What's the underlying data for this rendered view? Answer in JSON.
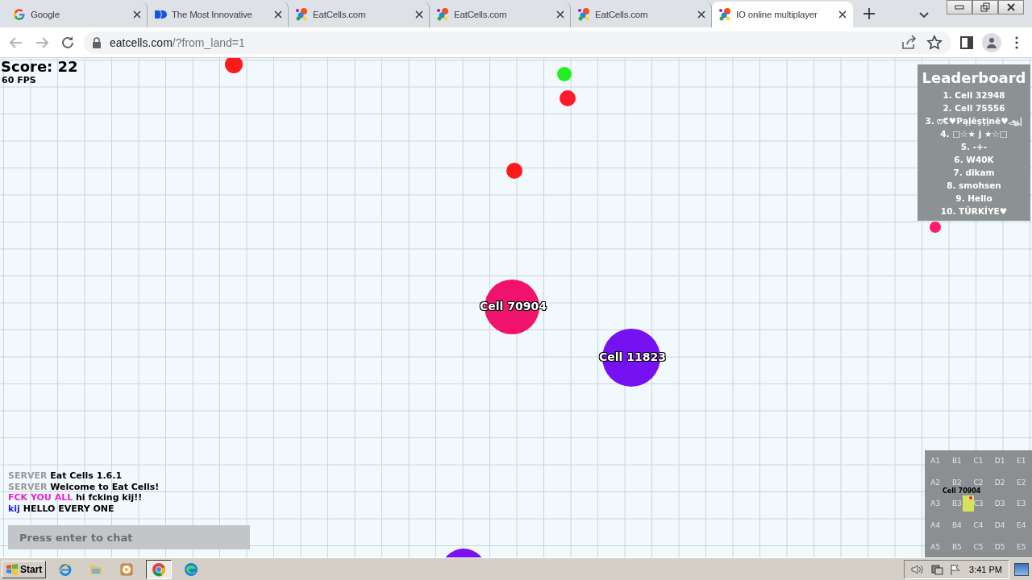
{
  "browser": {
    "tabs": [
      {
        "title": "Google",
        "kind": "google",
        "selected": false
      },
      {
        "title": "The Most Innovative",
        "kind": "flag",
        "selected": false
      },
      {
        "title": "EatCells.com",
        "kind": "cells",
        "selected": false
      },
      {
        "title": "EatCells.com",
        "kind": "cells",
        "selected": false
      },
      {
        "title": "EatCells.com",
        "kind": "cells",
        "selected": false
      },
      {
        "title": "IO online multiplayer",
        "kind": "cells",
        "selected": true
      }
    ],
    "address": {
      "host": "eatcells.com",
      "path": "/?from_land=1"
    }
  },
  "game": {
    "score": "Score: 22",
    "fps": "60 FPS",
    "pellets": [
      {
        "color": "#ff1a1a"
      },
      {
        "color": "#22ee22"
      },
      {
        "color": "#ff1a2a"
      },
      {
        "color": "#ff1a1a"
      },
      {
        "color": "#ff1a6a"
      }
    ],
    "cells": [
      {
        "name": "Cell 70904",
        "color": "#f0136e"
      },
      {
        "name": "Cell 11823",
        "color": "#7611f2"
      },
      {
        "color": "#7a11f0"
      }
    ],
    "leaderboard": {
      "title": "Leaderboard",
      "entries": [
        "1. Cell 32948",
        "2. Cell 75556",
        "3. ෆ€♥Pąļēşţįnē♥ஆ|",
        "4. □☆★ j ★☆□",
        "5. -+-",
        "6. W40K",
        "7. dikam",
        "8. smohsen",
        "9. Hello",
        "10. TÜRKİYE♥"
      ]
    },
    "chat": {
      "messages": [
        {
          "sender": "SERVER",
          "color": "#999999",
          "text": "Eat Cells 1.6.1"
        },
        {
          "sender": "SERVER",
          "color": "#999999",
          "text": "Welcome to Eat Cells!"
        },
        {
          "sender": "FCK YOU ALL",
          "color": "#ee22cc",
          "text": "hi fcking kij!!"
        },
        {
          "sender": "kij",
          "color": "#2222dd",
          "text": "HELLO EVERY ONE"
        }
      ],
      "placeholder": "Press enter to chat"
    },
    "minimap": {
      "cells": [
        "A1",
        "B1",
        "C1",
        "D1",
        "E1",
        "A2",
        "B2",
        "C2",
        "D2",
        "E2",
        "A3",
        "B3",
        "C3",
        "D3",
        "E3",
        "A4",
        "B4",
        "C4",
        "D4",
        "E4",
        "A5",
        "B5",
        "C5",
        "D5",
        "E5"
      ],
      "player": "Cell 70904"
    }
  },
  "taskbar": {
    "start": "Start",
    "apps": [
      {
        "kind": "ie",
        "selected": false
      },
      {
        "kind": "folder",
        "selected": false
      },
      {
        "kind": "media",
        "selected": false
      },
      {
        "kind": "chrome",
        "selected": true
      },
      {
        "kind": "edge",
        "selected": false
      }
    ],
    "clock": "3:41 PM"
  }
}
